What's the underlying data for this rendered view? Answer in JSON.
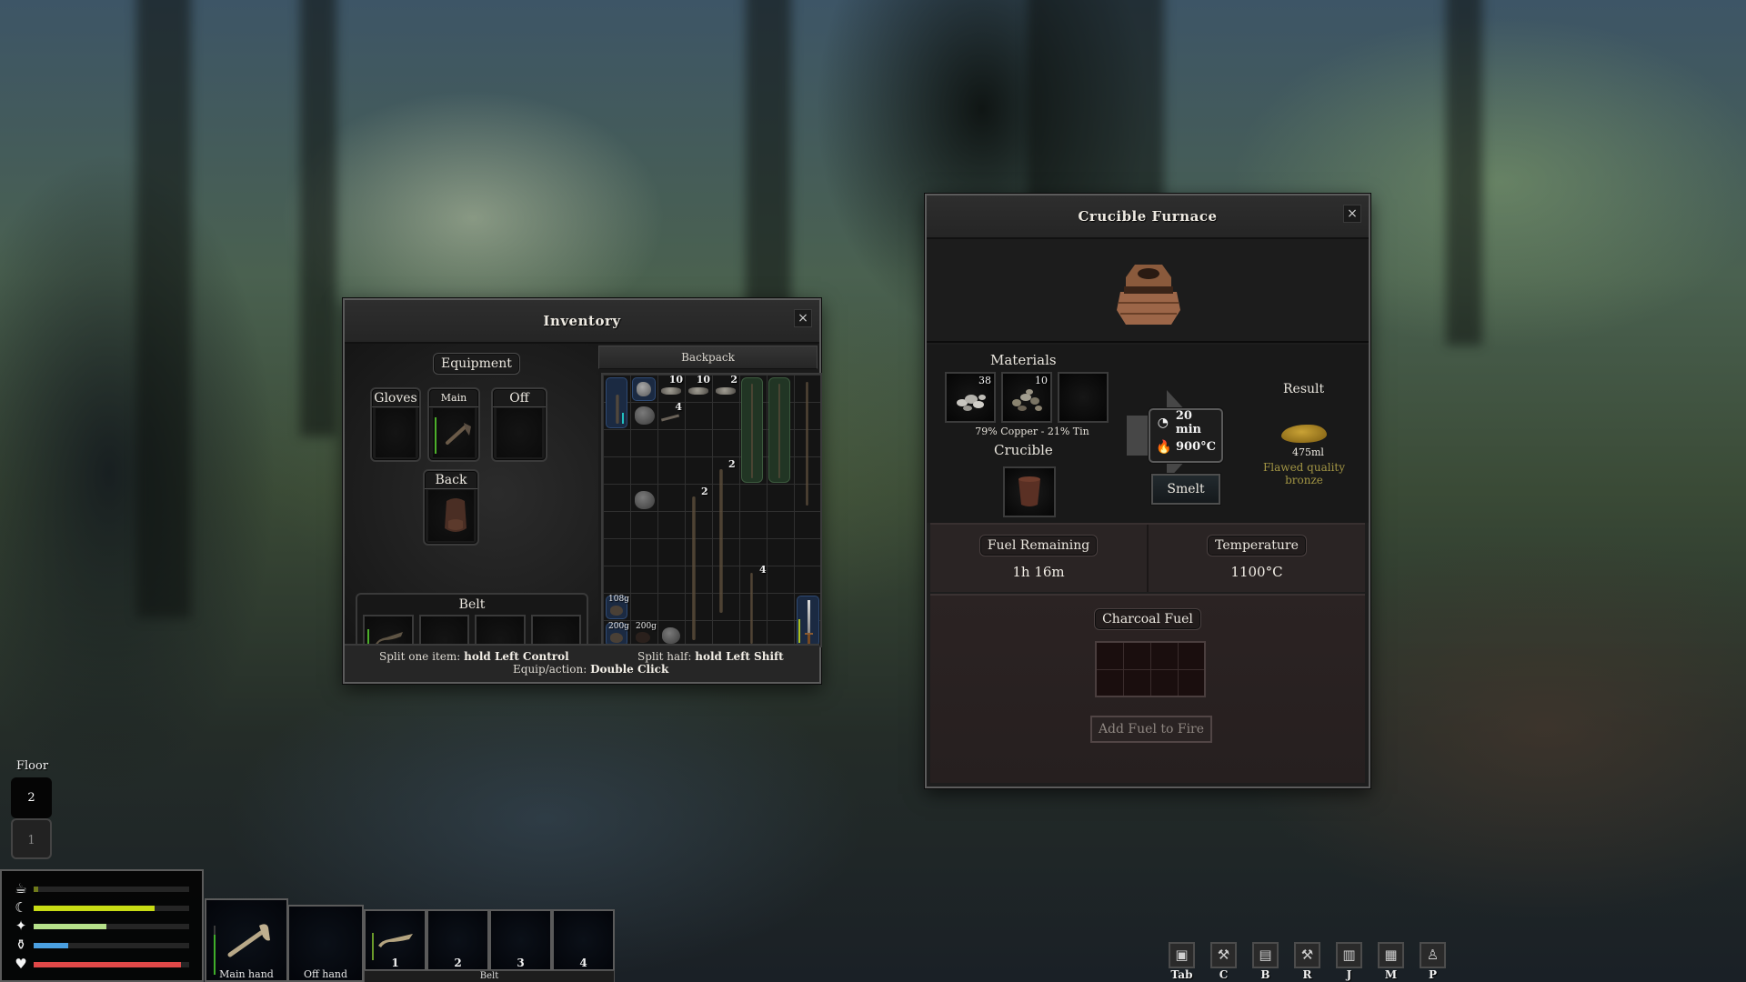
{
  "inventory": {
    "title": "Inventory",
    "close_icon": "×",
    "equipment": {
      "title": "Equipment",
      "slots": [
        {
          "label": "Gloves",
          "item": null
        },
        {
          "label": "Main hand",
          "item": "hatchet",
          "durability": 0.9
        },
        {
          "label": "Off hand",
          "item": null
        },
        {
          "label": "Back",
          "item": "backpack"
        }
      ],
      "belt": {
        "title": "Belt",
        "slots": [
          {
            "number": "1",
            "item": "knife",
            "durability": 0.75
          },
          {
            "number": "2",
            "item": null
          },
          {
            "number": "3",
            "item": null
          },
          {
            "number": "4",
            "item": null
          }
        ]
      }
    },
    "backpack": {
      "title": "Backpack",
      "columns": 8,
      "rows": 10,
      "counts": [
        "10",
        "10",
        "2",
        "4",
        "2",
        "2",
        "4"
      ],
      "weights": [
        "108g",
        "200g",
        "200g"
      ]
    },
    "hints": {
      "split_one_label": "Split one item:",
      "split_one_key": "hold Left Control",
      "split_half_label": "Split half:",
      "split_half_key": "hold Left Shift",
      "equip_label": "Equip/action:",
      "equip_key": "Double Click"
    }
  },
  "furnace": {
    "title": "Crucible Furnace",
    "close_icon": "×",
    "materials": {
      "title": "Materials",
      "slots": [
        {
          "count": "38",
          "item": "copper-ore"
        },
        {
          "count": "10",
          "item": "tin-ore"
        },
        {
          "count": "",
          "item": null
        }
      ],
      "ratio": "79% Copper - 21% Tin"
    },
    "crucible": {
      "title": "Crucible",
      "item": "clay-crucible"
    },
    "process": {
      "time_icon": "◔",
      "time": "20 min",
      "temp_icon": "🔥",
      "temperature": "900°C",
      "smelt_label": "Smelt"
    },
    "result": {
      "title": "Result",
      "volume": "475ml",
      "name": "Flawed quality bronze",
      "color": "#a29544"
    },
    "fuel": {
      "remaining_label": "Fuel Remaining",
      "remaining_value": "1h 16m",
      "temperature_label": "Temperature",
      "temperature_value": "1100°C",
      "charcoal_label": "Charcoal Fuel",
      "add_fuel_label": "Add Fuel to Fire"
    }
  },
  "hud": {
    "floor": {
      "label": "Floor",
      "options": [
        "2",
        "1"
      ],
      "current": "2"
    },
    "stats": [
      {
        "name": "hunger",
        "icon": "☕",
        "value": 0.03,
        "color": "#6f7a1a"
      },
      {
        "name": "sleep",
        "icon": "☾",
        "value": 0.78,
        "color": "#c8dc14"
      },
      {
        "name": "energy",
        "icon": "✦",
        "value": 0.47,
        "color": "#b5e08a"
      },
      {
        "name": "thirst",
        "icon": "⚱",
        "value": 0.22,
        "color": "#4a9fe0"
      },
      {
        "name": "health",
        "icon": "♥",
        "value": 0.95,
        "color": "#e04848"
      }
    ],
    "hotbar": {
      "main_hand_label": "Main hand",
      "off_hand_label": "Off hand",
      "belt_label": "Belt",
      "belt_numbers": [
        "1",
        "2",
        "3",
        "4"
      ]
    },
    "hotkeys": [
      {
        "key": "Tab",
        "icon": "inventory-icon",
        "glyph": "▣"
      },
      {
        "key": "C",
        "icon": "crafting-icon",
        "glyph": "⚒"
      },
      {
        "key": "B",
        "icon": "building-icon",
        "glyph": "▤"
      },
      {
        "key": "R",
        "icon": "repair-hammer-icon",
        "glyph": "⚒"
      },
      {
        "key": "J",
        "icon": "journal-icon",
        "glyph": "▥"
      },
      {
        "key": "M",
        "icon": "map-icon",
        "glyph": "▦"
      },
      {
        "key": "P",
        "icon": "player-icon",
        "glyph": "♙"
      }
    ]
  }
}
